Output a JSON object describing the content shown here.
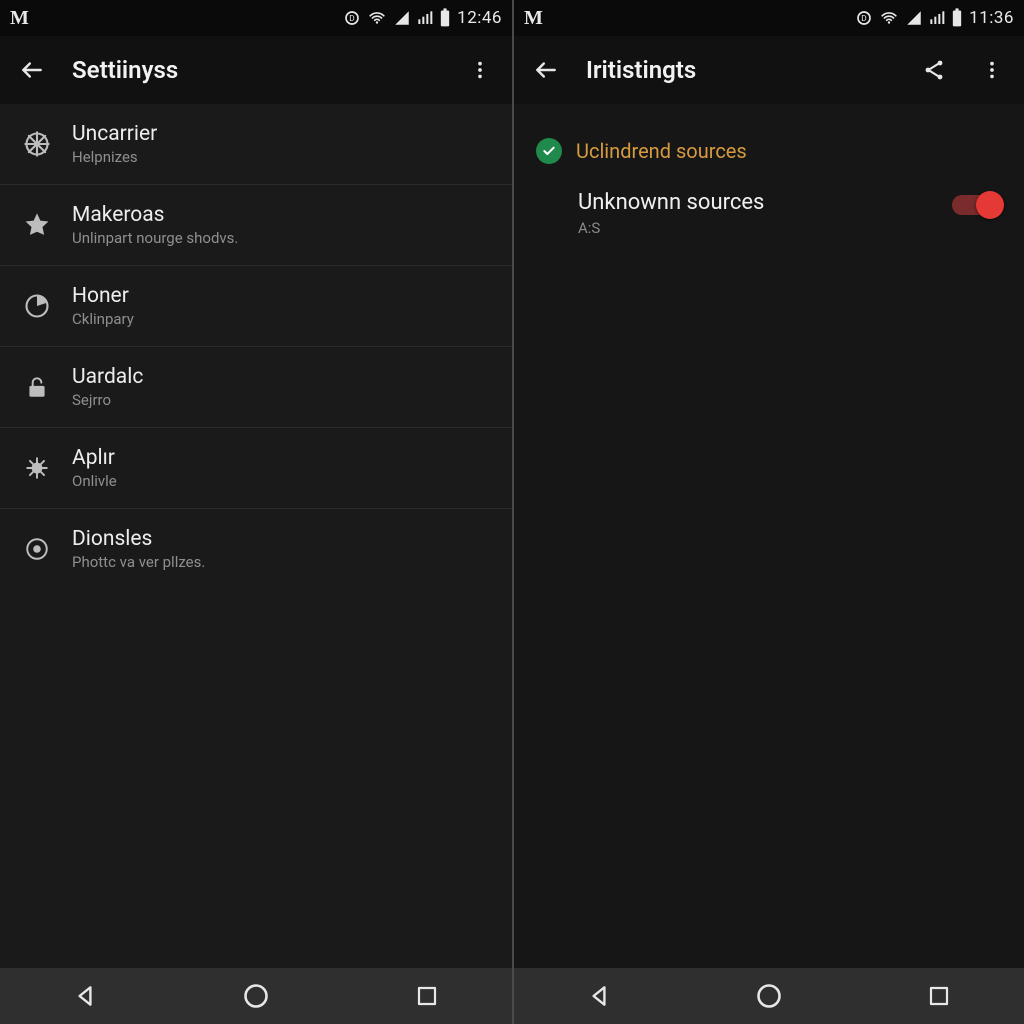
{
  "left": {
    "status": {
      "carrier_glyph": "M",
      "time": "12:46"
    },
    "appbar": {
      "title": "Settiinyss"
    },
    "items": [
      {
        "icon": "wheel-icon",
        "label": "Uncarrier",
        "sub": "Helpnizes"
      },
      {
        "icon": "star-icon",
        "label": "Makeroas",
        "sub": "Unlinpart nourge shodvs."
      },
      {
        "icon": "timer-icon",
        "label": "Honer",
        "sub": "Cklinpary"
      },
      {
        "icon": "lock-icon",
        "label": "Uardalc",
        "sub": "Sejrro"
      },
      {
        "icon": "bug-icon",
        "label": "Aplır",
        "sub": "Onlivle"
      },
      {
        "icon": "target-icon",
        "label": "Dionsles",
        "sub": "Phottc va ver pllzes."
      }
    ]
  },
  "right": {
    "status": {
      "carrier_glyph": "M",
      "time": "11:36"
    },
    "appbar": {
      "title": "Iritistingts"
    },
    "section": {
      "title": "Uclindrend sources"
    },
    "setting": {
      "label": "Unknownn sources",
      "sub": "A:S",
      "enabled": true
    }
  }
}
